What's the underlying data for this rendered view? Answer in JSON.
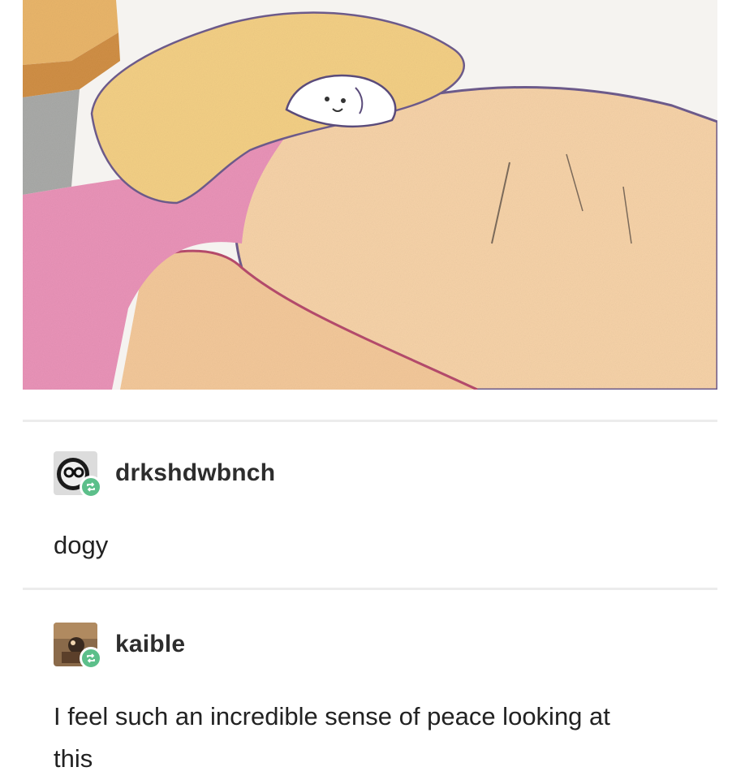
{
  "post": {
    "image_alt_icon": "drawing-image"
  },
  "reblogs": [
    {
      "username": "drkshdwbnch",
      "avatar_icon": "sunglasses-avatar",
      "badge_icon": "reblog-icon",
      "comment": "dogy"
    },
    {
      "username": "kaible",
      "avatar_icon": "photo-avatar",
      "badge_icon": "reblog-icon",
      "comment": "I feel such an incredible sense of peace looking at this"
    }
  ],
  "colors": {
    "reblog_badge": "#5cbf8a",
    "divider": "#ececec",
    "text": "#222222"
  }
}
